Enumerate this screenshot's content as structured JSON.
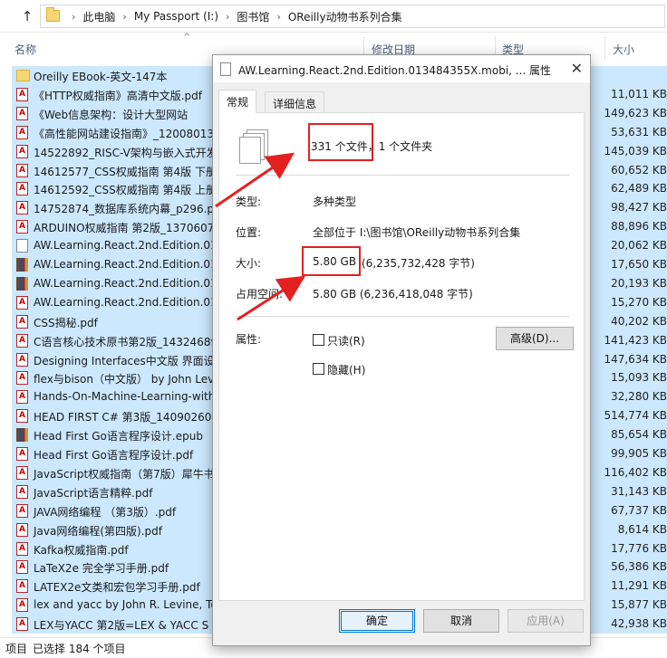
{
  "address": {
    "crumbs": [
      "此电脑",
      "My Passport (I:)",
      "图书馆",
      "OReilly动物书系列合集"
    ]
  },
  "columns": {
    "name": "名称",
    "modified": "修改日期",
    "type": "类型",
    "size": "大小"
  },
  "files": [
    {
      "name": "Oreilly  EBook-英文-147本",
      "size": "",
      "icon": "folder"
    },
    {
      "name": "《HTTP权威指南》高清中文版.pdf",
      "size": "11,011 KB",
      "icon": "pdf"
    },
    {
      "name": "《Web信息架构：设计大型网站",
      "size": "149,623 KB",
      "icon": "pdf"
    },
    {
      "name": "《高性能网站建设指南》_12008013.",
      "size": "53,631 KB",
      "icon": "pdf"
    },
    {
      "name": "14522892_RISC-V架构与嵌入式开发",
      "size": "145,039 KB",
      "icon": "pdf"
    },
    {
      "name": "14612577_CSS权威指南  第4版  下册",
      "size": "60,652 KB",
      "icon": "pdf"
    },
    {
      "name": "14612592_CSS权威指南  第4版  上册",
      "size": "62,489 KB",
      "icon": "pdf"
    },
    {
      "name": "14752874_数据库系统内幕_p296.pdf",
      "size": "98,427 KB",
      "icon": "pdf"
    },
    {
      "name": "ARDUINO权威指南  第2版_1370607",
      "size": "88,896 KB",
      "icon": "pdf"
    },
    {
      "name": "AW.Learning.React.2nd.Edition.013",
      "size": "20,062 KB",
      "icon": "file"
    },
    {
      "name": "AW.Learning.React.2nd.Edition.013",
      "size": "17,650 KB",
      "icon": "epub"
    },
    {
      "name": "AW.Learning.React.2nd.Edition.013",
      "size": "20,193 KB",
      "icon": "epub"
    },
    {
      "name": "AW.Learning.React.2nd.Edition.013",
      "size": "15,270 KB",
      "icon": "pdf"
    },
    {
      "name": "CSS揭秘.pdf",
      "size": "40,202 KB",
      "icon": "pdf"
    },
    {
      "name": "C语言核心技术原书第2版_14324689.",
      "size": "141,423 KB",
      "icon": "pdf"
    },
    {
      "name": "Designing Interfaces中文版 界面设计",
      "size": "147,634 KB",
      "icon": "pdf"
    },
    {
      "name": "flex与bison（中文版） by John Lev",
      "size": "15,093 KB",
      "icon": "pdf"
    },
    {
      "name": "Hands-On-Machine-Learning-with",
      "size": "32,280 KB",
      "icon": "pdf"
    },
    {
      "name": "HEAD FIRST C#  第3版_14090260.p",
      "size": "514,774 KB",
      "icon": "pdf"
    },
    {
      "name": "Head First Go语言程序设计.epub",
      "size": "85,654 KB",
      "icon": "epub"
    },
    {
      "name": "Head First Go语言程序设计.pdf",
      "size": "99,905 KB",
      "icon": "pdf"
    },
    {
      "name": "JavaScript权威指南（第7版）犀牛书",
      "size": "116,402 KB",
      "icon": "pdf"
    },
    {
      "name": "JavaScript语言精粹.pdf",
      "size": "31,143 KB",
      "icon": "pdf"
    },
    {
      "name": "JAVA网络编程  （第3版）.pdf",
      "size": "67,737 KB",
      "icon": "pdf"
    },
    {
      "name": "Java网络编程(第四版).pdf",
      "size": "8,614 KB",
      "icon": "pdf"
    },
    {
      "name": "Kafka权威指南.pdf",
      "size": "17,776 KB",
      "icon": "pdf"
    },
    {
      "name": "LaTeX2e 完全学习手册.pdf",
      "size": "56,386 KB",
      "icon": "pdf"
    },
    {
      "name": "LATEX2e文类和宏包学习手册.pdf",
      "size": "11,291 KB",
      "icon": "pdf"
    },
    {
      "name": "lex and yacc by John R. Levine, To",
      "size": "15,877 KB",
      "icon": "pdf"
    },
    {
      "name": "LEX与YACC  第2版=LEX & YACC  S",
      "size": "42,938 KB",
      "icon": "pdf"
    }
  ],
  "status": {
    "count_label": "项目",
    "selected": "已选择 184 个项目"
  },
  "dialog": {
    "title": "AW.Learning.React.2nd.Edition.013484355X.mobi, ... 属性",
    "tabs": [
      "常规",
      "详细信息"
    ],
    "summary": "331 个文件，1 个文件夹",
    "type_label": "类型:",
    "type_value": "多种类型",
    "location_label": "位置:",
    "location_value": "全部位于 I:\\图书馆\\OReilly动物书系列合集",
    "size_label": "大小:",
    "size_value": "5.80 GB",
    "size_bytes": "(6,235,732,428 字节)",
    "disk_label": "占用空间:",
    "disk_value": "5.80 GB (6,236,418,048 字节)",
    "attr_label": "属性:",
    "readonly_label": "只读(R)",
    "hidden_label": "隐藏(H)",
    "advanced_button": "高级(D)...",
    "ok_button": "确定",
    "cancel_button": "取消",
    "apply_button": "应用(A)"
  }
}
